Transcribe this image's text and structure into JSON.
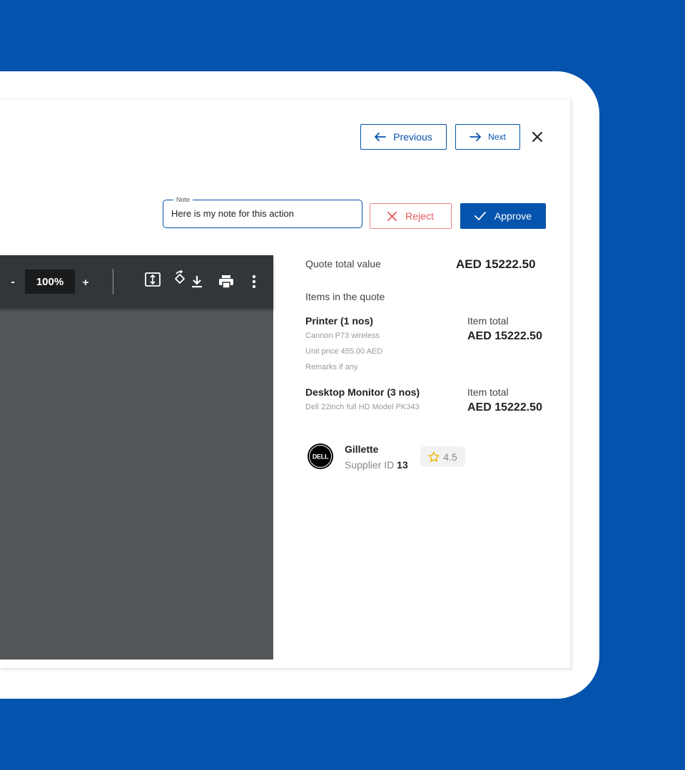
{
  "nav": {
    "previous_label": "Previous",
    "next_label": "Next"
  },
  "note": {
    "legend": "Note",
    "value": "Here is my note for this action"
  },
  "actions": {
    "reject_label": "Reject",
    "approve_label": "Approve"
  },
  "viewer": {
    "zoom_minus": "-",
    "zoom_level": "100%",
    "zoom_plus": "+"
  },
  "summary": {
    "quote_total_label": "Quote total value",
    "quote_total_value": "AED 15222.50",
    "items_heading": "Items in the quote",
    "items": [
      {
        "name": "Printer (1 nos)",
        "description": "Cannon P73 wireless",
        "unit_price": "Unit price  455.00 AED",
        "remarks": "Remarks if any",
        "total_label": "Item total",
        "total_value": "AED 15222.50"
      },
      {
        "name": "Desktop Monitor (3 nos)",
        "description": "Dell 22inch full HD Model PK343",
        "total_label": "Item total",
        "total_value": "AED 15222.50"
      }
    ]
  },
  "supplier": {
    "logo_text": "DELL",
    "name": "Gillette",
    "id_label": "Supplier ID ",
    "id_value": "13",
    "rating": "4.5"
  },
  "colors": {
    "brand": "#0453AC",
    "reject": "#E8585E",
    "viewer_bg": "#525659",
    "toolbar_bg": "#323639",
    "star": "#F2B705"
  }
}
